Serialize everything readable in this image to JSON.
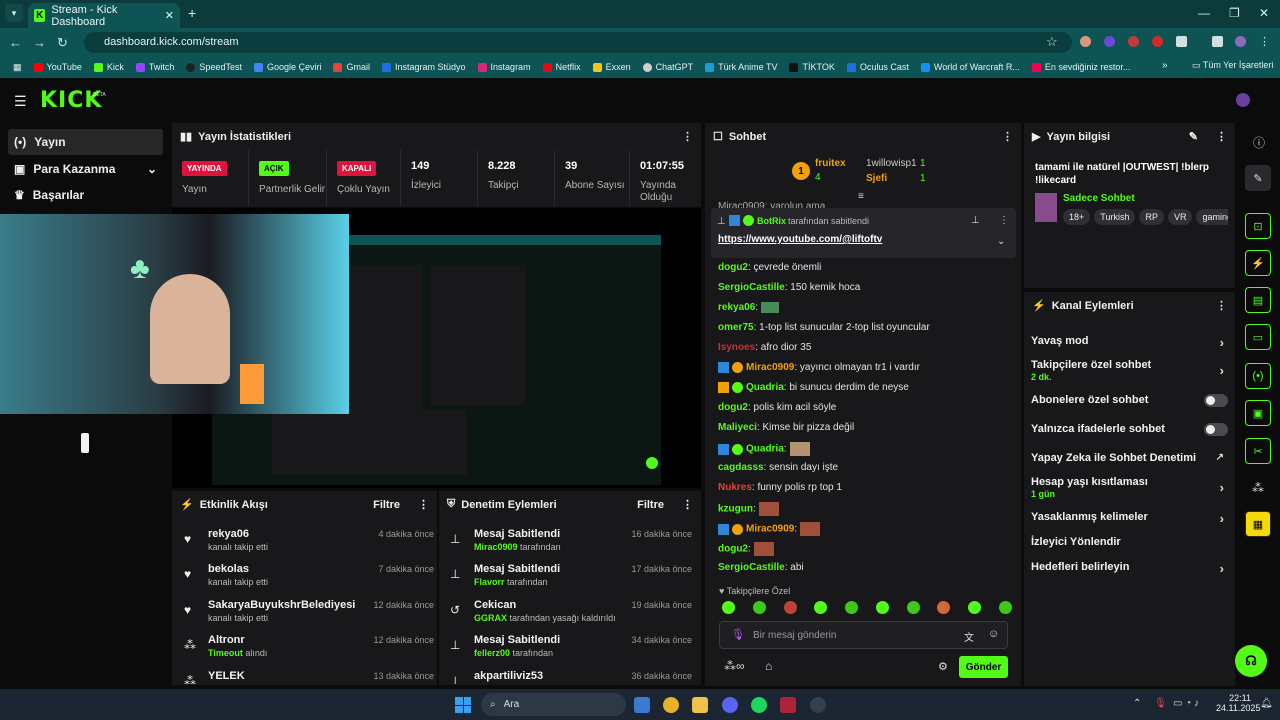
{
  "browser": {
    "tab_title": "Stream - Kick Dashboard",
    "url": "dashboard.kick.com/stream",
    "bookmarks": [
      "YouTube",
      "Kick",
      "Twitch",
      "SpeedTest",
      "Google Çeviri",
      "Gmail",
      "Instagram Stüdyo",
      "Instagram",
      "Netflix",
      "Exxen",
      "ChatGPT",
      "Türk Anime TV",
      "TİKTOK",
      "Oculus Cast",
      "World of Warcraft R...",
      "En sevdiğiniz restor..."
    ],
    "all_bookmarks": "Tüm Yer İşaretleri"
  },
  "kick": {
    "logo": "KICK",
    "beta": "BETA"
  },
  "sidebar": {
    "items": [
      {
        "label": "Yayın",
        "icon": "broadcast-icon"
      },
      {
        "label": "Para Kazanma",
        "icon": "money-icon"
      },
      {
        "label": "Başarılar",
        "icon": "trophy-icon"
      }
    ]
  },
  "stats": {
    "title": "Yayın İstatistikleri",
    "items": [
      {
        "badge": "YAYINDA",
        "label": "Yayın",
        "color": "#e0133c"
      },
      {
        "badge": "AÇIK",
        "label": "Partnerlik Gelir",
        "color": "#53fc18"
      },
      {
        "badge": "KAPALI",
        "label": "Çoklu Yayın",
        "color": "#e0133c"
      },
      {
        "value": "149",
        "label": "İzleyici"
      },
      {
        "value": "8.228",
        "label": "Takipçi"
      },
      {
        "value": "39",
        "label": "Abone Sayısı"
      },
      {
        "value": "01:07:55",
        "label": "Yayında Olduğu"
      }
    ]
  },
  "activity": {
    "title": "Etkinlik Akışı",
    "filter": "Filtre",
    "rows": [
      {
        "name": "rekya06",
        "sub": "kanalı takip etti",
        "time": "4 dakika önce",
        "icon": "heart-icon"
      },
      {
        "name": "bekolas",
        "sub": "kanalı takip etti",
        "time": "7 dakika önce",
        "icon": "heart-icon"
      },
      {
        "name": "SakaryaBuyukshrBelediyesi",
        "sub": "kanalı takip etti",
        "time": "12 dakika önce",
        "icon": "heart-icon"
      },
      {
        "name": "Altronr",
        "sub": "Timeout",
        "sub2": " alındı",
        "time": "12 dakika önce",
        "icon": "gift-icon"
      },
      {
        "name": "YELEK",
        "sub": "",
        "time": "13 dakika önce",
        "icon": "gift-icon"
      }
    ]
  },
  "moderation": {
    "title": "Denetim Eylemleri",
    "filter": "Filtre",
    "rows": [
      {
        "name": "Mesaj Sabitlendi",
        "user": "Mirac0909",
        "sub": " tarafından",
        "time": "16 dakika önce",
        "icon": "pin-icon"
      },
      {
        "name": "Mesaj Sabitlendi",
        "user": "Flavorr",
        "sub": " tarafından",
        "time": "17 dakika önce",
        "icon": "pin-icon"
      },
      {
        "name": "Cekican",
        "user": "GGRAX",
        "sub": " tarafından yasağı kaldırıldı",
        "time": "19 dakika önce",
        "icon": "undo-icon"
      },
      {
        "name": "Mesaj Sabitlendi",
        "user": "fellerz00",
        "sub": " tarafından",
        "time": "34 dakika önce",
        "icon": "pin-icon"
      },
      {
        "name": "akpartiliviz53",
        "user": "",
        "sub": "",
        "time": "36 dakika önce",
        "icon": "pin-icon"
      }
    ]
  },
  "chat": {
    "title": "Sohbet",
    "top": [
      {
        "name": "fruitex",
        "count": "4"
      },
      {
        "name": "1willowisp1",
        "count": "1"
      },
      {
        "name": "Sjefi",
        "count": "1"
      }
    ],
    "pinned_by": "BotRix",
    "pinned_suffix": "tarafından sabitlendi",
    "pinned_link": "https://www.youtube.com/@liftoftv",
    "partial_top": "Mirac0909: yarolun ama",
    "messages": [
      {
        "user": "dogu2",
        "color": "#53fc18",
        "text": ": çevrede önemli"
      },
      {
        "user": "SergioCastille",
        "color": "#53fc18",
        "text": ": 150 kemik hoca"
      },
      {
        "user": "rekya06",
        "color": "#53fc18",
        "text": ":"
      },
      {
        "user": "omer75",
        "color": "#53fc18",
        "text": ": 1-top list sunucular 2-top list oyuncular"
      },
      {
        "user": "Isynoes",
        "color": "#d03030",
        "text": ": afro dior 35"
      },
      {
        "user": "Mirac0909",
        "color": "#f1a10a",
        "text": ": yayıncı olmayan tr1 i vardır"
      },
      {
        "user": "Quadria",
        "color": "#53fc18",
        "text": ": bi sunucu derdim de neyse"
      },
      {
        "user": "dogu2",
        "color": "#53fc18",
        "text": ": polis kim acil söyle"
      },
      {
        "user": "Maliyeci",
        "color": "#53fc18",
        "text": ": Kimse bir pizza değil"
      },
      {
        "user": "Quadria",
        "color": "#53fc18",
        "text": ":"
      },
      {
        "user": "cagdasss",
        "color": "#53fc18",
        "text": ": sensin dayı işte"
      },
      {
        "user": "Nukres",
        "color": "#e0443a",
        "text": ": funny polis rp top 1"
      },
      {
        "user": "kzugun",
        "color": "#53fc18",
        "text": ":"
      },
      {
        "user": "Mirac0909",
        "color": "#f1a10a",
        "text": ":"
      },
      {
        "user": "dogu2",
        "color": "#53fc18",
        "text": ":"
      },
      {
        "user": "SergioCastille",
        "color": "#53fc18",
        "text": ": abi"
      }
    ],
    "followers_only": "Takipçilere Özel",
    "input_placeholder": "Bir mesaj gönderin",
    "send": "Gönder"
  },
  "info": {
    "title": "Yayın bilgisi",
    "stream_title": "tamami ile natürel |OUTWEST| !blerp !likecard",
    "category": "Sadece Sohbet",
    "tags": [
      "18+",
      "Turkish",
      "RP",
      "VR",
      "gaming"
    ]
  },
  "channel_actions": {
    "title": "Kanal Eylemleri",
    "items": [
      {
        "label": "Yavaş mod",
        "kind": "chevron"
      },
      {
        "label": "Takipçilere özel sohbet",
        "sub": "2 dk.",
        "kind": "chevron"
      },
      {
        "label": "Abonelere özel sohbet",
        "kind": "toggle"
      },
      {
        "label": "Yalnızca ifadelerle sohbet",
        "kind": "toggle"
      },
      {
        "label": "Yapay Zeka ile Sohbet Denetimi",
        "kind": "external"
      },
      {
        "label": "Hesap yaşı kısıtlaması",
        "sub": "1 gün",
        "kind": "chevron"
      },
      {
        "label": "Yasaklanmış kelimeler",
        "kind": "chevron"
      },
      {
        "label": "İzleyici Yönlendir",
        "kind": "none"
      },
      {
        "label": "Hedefleri belirleyin",
        "kind": "chevron"
      }
    ]
  },
  "taskbar": {
    "search": "Ara",
    "time": "22:11",
    "date": "24.11.2025"
  }
}
